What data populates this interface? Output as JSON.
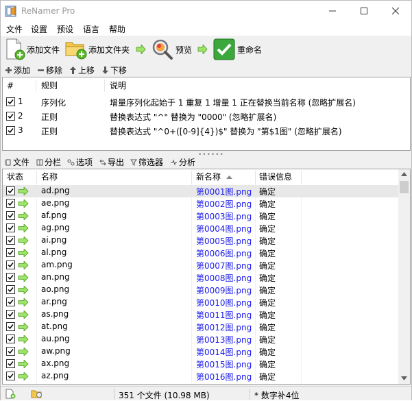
{
  "window": {
    "title": "ReNamer Pro"
  },
  "menu": [
    "文件",
    "设置",
    "预设",
    "语言",
    "帮助"
  ],
  "toolbar": {
    "add_files": "添加文件",
    "add_folders": "添加文件夹",
    "preview": "预览",
    "rename": "重命名"
  },
  "rules_toolbar": {
    "add": "添加",
    "remove": "移除",
    "up": "上移",
    "down": "下移"
  },
  "rules_header": {
    "num": "#",
    "rule": "规则",
    "desc": "说明"
  },
  "rules": [
    {
      "num": "1",
      "rule": "序列化",
      "desc": "增量序列化起始于 1 重复 1 增量 1 正在替换当前名称 (忽略扩展名)",
      "checked": true
    },
    {
      "num": "2",
      "rule": "正则",
      "desc": "替换表达式 \"^\" 替换为 \"0000\" (忽略扩展名)",
      "checked": true
    },
    {
      "num": "3",
      "rule": "正则",
      "desc": "替换表达式 \"^0+([0-9]{4})$\" 替换为 \"第$1图\" (忽略扩展名)",
      "checked": true
    }
  ],
  "files_toolbar": {
    "files": "文件",
    "columns": "分栏",
    "options": "选项",
    "export": "导出",
    "filter": "筛选器",
    "analyze": "分析"
  },
  "files_header": {
    "status": "状态",
    "name": "名称",
    "new_name": "新名称",
    "error": "错误信息"
  },
  "files": [
    {
      "name": "ad.png",
      "new_name": "第0001图.png",
      "error": "确定"
    },
    {
      "name": "ae.png",
      "new_name": "第0002图.png",
      "error": "确定"
    },
    {
      "name": "af.png",
      "new_name": "第0003图.png",
      "error": "确定"
    },
    {
      "name": "ag.png",
      "new_name": "第0004图.png",
      "error": "确定"
    },
    {
      "name": "ai.png",
      "new_name": "第0005图.png",
      "error": "确定"
    },
    {
      "name": "al.png",
      "new_name": "第0006图.png",
      "error": "确定"
    },
    {
      "name": "am.png",
      "new_name": "第0007图.png",
      "error": "确定"
    },
    {
      "name": "an.png",
      "new_name": "第0008图.png",
      "error": "确定"
    },
    {
      "name": "ao.png",
      "new_name": "第0009图.png",
      "error": "确定"
    },
    {
      "name": "ar.png",
      "new_name": "第0010图.png",
      "error": "确定"
    },
    {
      "name": "as.png",
      "new_name": "第0011图.png",
      "error": "确定"
    },
    {
      "name": "at.png",
      "new_name": "第0012图.png",
      "error": "确定"
    },
    {
      "name": "au.png",
      "new_name": "第0013图.png",
      "error": "确定"
    },
    {
      "name": "aw.png",
      "new_name": "第0014图.png",
      "error": "确定"
    },
    {
      "name": "ax.png",
      "new_name": "第0015图.png",
      "error": "确定"
    },
    {
      "name": "az.png",
      "new_name": "第0016图.png",
      "error": "确定"
    }
  ],
  "status": {
    "count": "351 个文件 (10.98 MB)",
    "note": "* 数字补4位"
  },
  "colors": {
    "accent_new_name": "#1a1aee",
    "arrow_green": "#4cbb17",
    "rename_green": "#3aa83a"
  }
}
